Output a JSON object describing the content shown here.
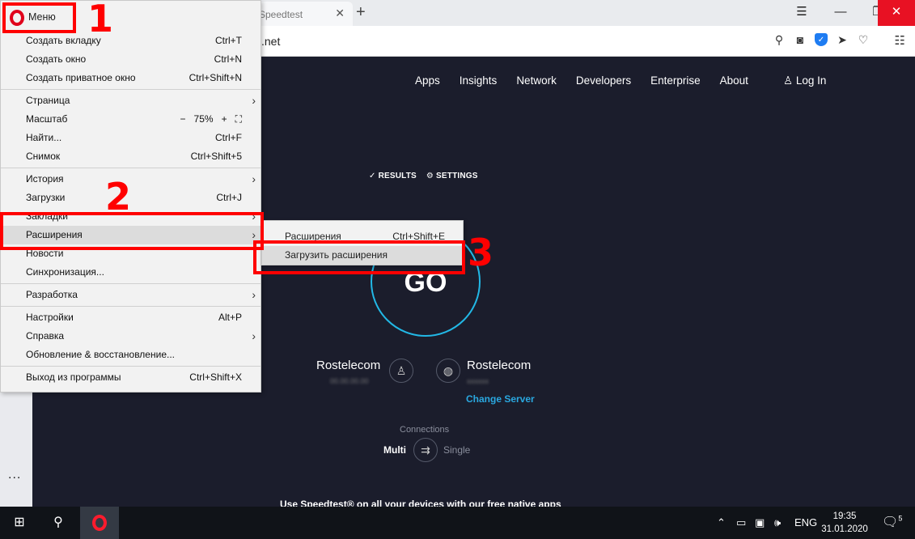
{
  "browser": {
    "tab_title": "Speedtest",
    "address_suffix": ".net",
    "address_icons": [
      "search-icon",
      "camera-icon",
      "vpn-shield-icon",
      "send-icon",
      "heart-icon"
    ],
    "sidebar_more": "..."
  },
  "site": {
    "nav": [
      "Apps",
      "Insights",
      "Network",
      "Developers",
      "Enterprise",
      "About"
    ],
    "login": "Log In",
    "results": "RESULTS",
    "settings": "SETTINGS",
    "go": "GO",
    "isp_left": "Rostelecom",
    "isp_right": "Rostelecom",
    "change_server": "Change Server",
    "connections": "Connections",
    "multi": "Multi",
    "single": "Single",
    "apps_text": "Use Speedtest® on all your devices with our free native apps"
  },
  "menu": {
    "button_label": "Меню",
    "items": [
      {
        "label": "Создать вкладку",
        "shortcut": "Ctrl+T"
      },
      {
        "label": "Создать окно",
        "shortcut": "Ctrl+N"
      },
      {
        "label": "Создать приватное окно",
        "shortcut": "Ctrl+Shift+N"
      },
      {
        "label": "Страница",
        "shortcut": ""
      },
      {
        "label": "Масштаб",
        "shortcut": ""
      },
      {
        "label": "Найти...",
        "shortcut": "Ctrl+F"
      },
      {
        "label": "Снимок",
        "shortcut": "Ctrl+Shift+5"
      },
      {
        "label": "История",
        "shortcut": ""
      },
      {
        "label": "Загрузки",
        "shortcut": "Ctrl+J"
      },
      {
        "label": "Закладки",
        "shortcut": ""
      },
      {
        "label": "Расширения",
        "shortcut": ""
      },
      {
        "label": "Новости",
        "shortcut": ""
      },
      {
        "label": "Синхронизация...",
        "shortcut": ""
      },
      {
        "label": "Разработка",
        "shortcut": ""
      },
      {
        "label": "Настройки",
        "shortcut": "Alt+P"
      },
      {
        "label": "Справка",
        "shortcut": ""
      },
      {
        "label": "Обновление & восстановление...",
        "shortcut": ""
      },
      {
        "label": "Выход из программы",
        "shortcut": "Ctrl+Shift+X"
      }
    ],
    "zoom": {
      "minus": "−",
      "value": "75%",
      "plus": "+"
    }
  },
  "submenu": {
    "items": [
      {
        "label": "Расширения",
        "shortcut": "Ctrl+Shift+E"
      },
      {
        "label": "Загрузить расширения",
        "shortcut": ""
      }
    ]
  },
  "annotations": [
    "1",
    "2",
    "3"
  ],
  "taskbar": {
    "language": "ENG",
    "time": "19:35",
    "date": "31.01.2020",
    "notifications": "5"
  },
  "colors": {
    "accent_red": "#ff0000",
    "opera_red": "#e0001b",
    "content_bg": "#1b1d2c",
    "link_blue": "#2aa8e0",
    "go_ring": "#22b8e6"
  }
}
